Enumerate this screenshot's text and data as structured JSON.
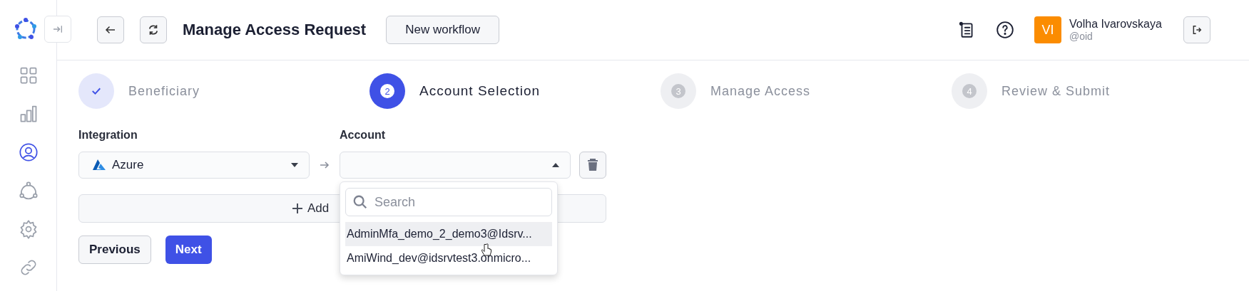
{
  "header": {
    "title": "Manage Access Request",
    "new_workflow_button": "New workflow",
    "user": {
      "initials": "VI",
      "name": "Volha Ivarovskaya",
      "handle": "@oid"
    }
  },
  "sidebar": {
    "items": [
      {
        "selected": false
      },
      {
        "selected": false
      },
      {
        "selected": true
      },
      {
        "selected": false
      },
      {
        "selected": false
      },
      {
        "selected": false
      }
    ]
  },
  "steps": [
    {
      "label": "Beneficiary",
      "completed": true,
      "selected": false
    },
    {
      "number": "2",
      "label": "Account Selection",
      "completed": false,
      "selected": true
    },
    {
      "number": "3",
      "label": "Manage Access",
      "completed": false,
      "selected": false
    },
    {
      "number": "4",
      "label": "Review & Submit",
      "completed": false,
      "selected": false
    }
  ],
  "form": {
    "integration_label": "Integration",
    "account_label": "Account",
    "integration_value": "Azure",
    "add_button": "Add",
    "account_dropdown": {
      "expanded": true,
      "search_placeholder": "Search",
      "options": [
        {
          "label": "AdminMfa_demo_2_demo3@Idsrv...",
          "selected": true
        },
        {
          "label": "AmiWind_dev@idsrvtest3.onmicro...",
          "selected": false
        }
      ]
    }
  },
  "buttons": {
    "previous": "Previous",
    "next": "Next"
  }
}
